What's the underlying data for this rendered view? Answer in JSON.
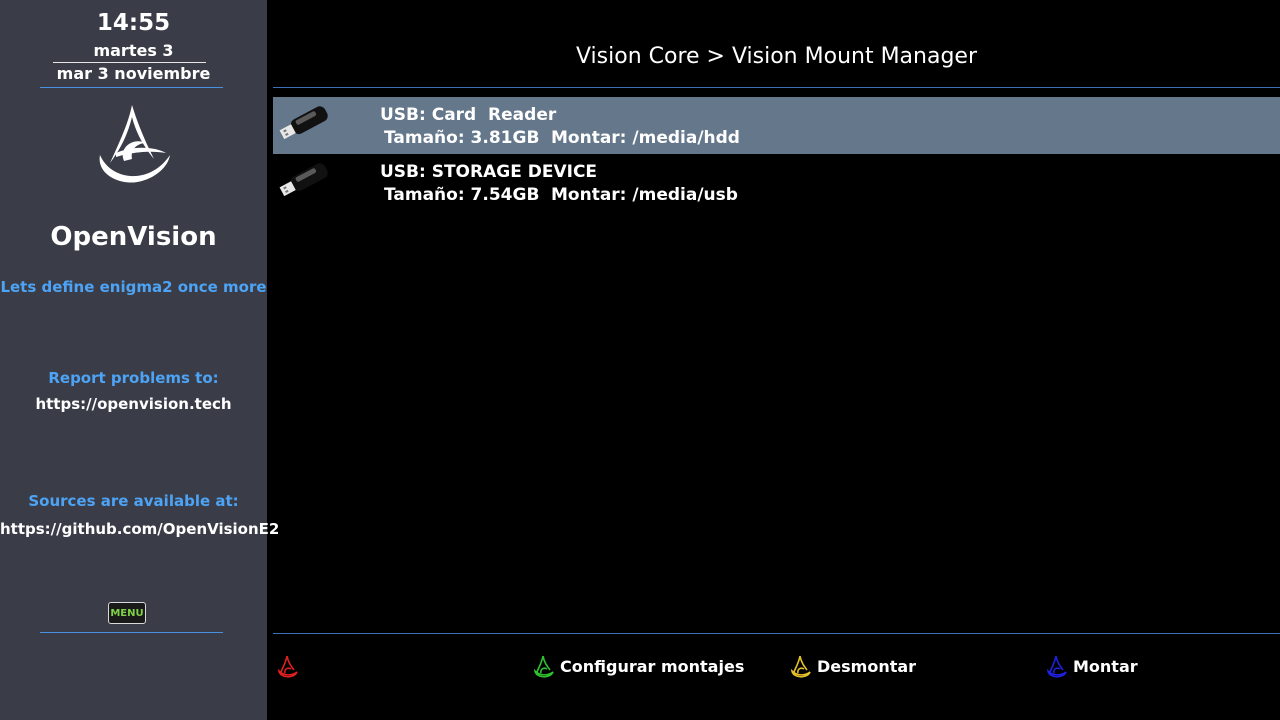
{
  "sidebar": {
    "clock": "14:55",
    "day": "martes 3",
    "date": "mar 3 noviembre",
    "brand": "OpenVision",
    "tagline": "Lets define enigma2 once more",
    "report_label": "Report problems to:",
    "report_url": "https://openvision.tech",
    "sources_label": "Sources are available at:",
    "sources_url": "https://github.com/OpenVisionE2",
    "menu_label": "MENU"
  },
  "header": {
    "title": "Vision Core > Vision Mount Manager"
  },
  "devices": [
    {
      "name": "USB: Card  Reader",
      "size": "Tamaño: 3.81GB",
      "mount": "Montar: /media/hdd",
      "selected": true,
      "icon": "usb-stick-icon"
    },
    {
      "name": "USB: STORAGE DEVICE",
      "size": "Tamaño: 7.54GB",
      "mount": "Montar: /media/usb",
      "selected": false,
      "icon": "usb-stick-icon"
    }
  ],
  "color_keys": [
    {
      "color": "red",
      "hex": "#e02020",
      "label": ""
    },
    {
      "color": "green",
      "hex": "#2fc22f",
      "label": "Configurar montajes"
    },
    {
      "color": "yellow",
      "hex": "#e6c02a",
      "label": "Desmontar"
    },
    {
      "color": "blue",
      "hex": "#2020e0",
      "label": "Montar"
    }
  ],
  "colors": {
    "sidebar_bg": "#3a3d47",
    "accent_blue": "#4da3f5",
    "selection_bg": "#65788b",
    "divider": "#3f6fb7"
  }
}
